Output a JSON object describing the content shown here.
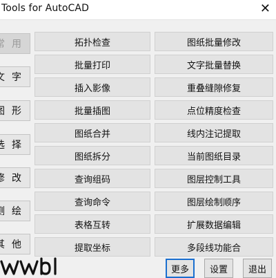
{
  "window": {
    "title": "Tools for AutoCAD",
    "close_glyph": "✕"
  },
  "sidebar": {
    "items": [
      {
        "label": "常用",
        "state": "active"
      },
      {
        "label": "文字"
      },
      {
        "label": "图形"
      },
      {
        "label": "选择"
      },
      {
        "label": "修改"
      },
      {
        "label": "测绘"
      },
      {
        "label": "其他"
      }
    ]
  },
  "grid": {
    "left": [
      "拓扑检查",
      "批量打印",
      "插入影像",
      "批量插图",
      "图纸合并",
      "图纸拆分",
      "查询组码",
      "查询命令",
      "表格互转",
      "提取坐标"
    ],
    "right": [
      "图纸批量修改",
      "文字批量替换",
      "重叠缝隙修复",
      "点位精度检查",
      "线内注记提取",
      "当前图纸目录",
      "图层控制工具",
      "图层绘制顺序",
      "扩展数据编辑",
      "多段线功能合"
    ]
  },
  "footer": {
    "more_label": "更多",
    "settings_label": "设置",
    "exit_label": "退出",
    "logo_icon": "logo-icon"
  }
}
